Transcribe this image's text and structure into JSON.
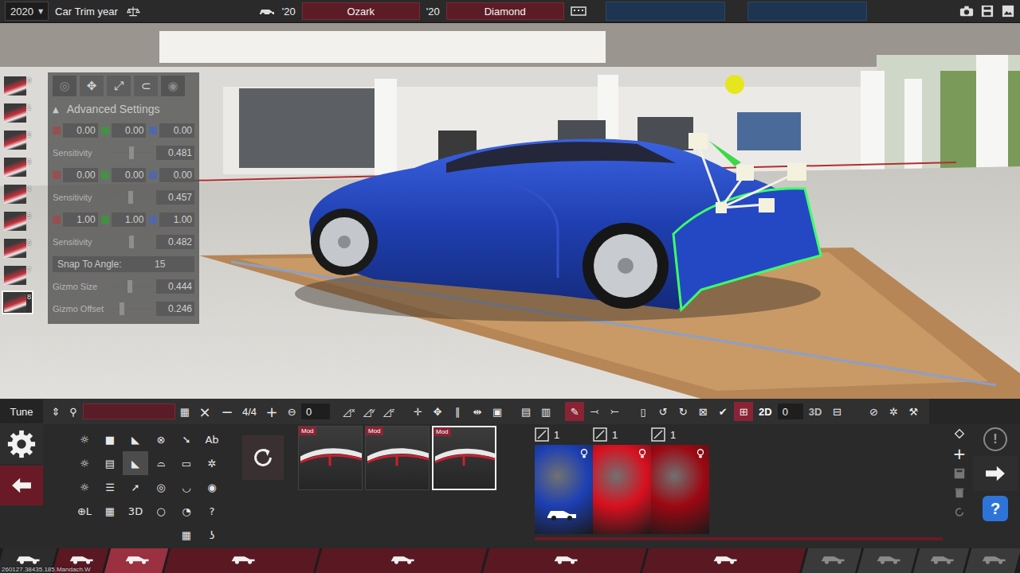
{
  "top_bar": {
    "year": {
      "value": "2020",
      "arrow": "▼"
    },
    "year_label": "Car Trim year",
    "model": {
      "year": "'20",
      "name": "Ozark"
    },
    "trim": {
      "year": "'20",
      "name": "Diamond"
    }
  },
  "fixtures": [
    {
      "index": "0",
      "selected": false
    },
    {
      "index": "1",
      "selected": false
    },
    {
      "index": "2",
      "selected": false
    },
    {
      "index": "3",
      "selected": false
    },
    {
      "index": "4",
      "selected": false
    },
    {
      "index": "5",
      "selected": false
    },
    {
      "index": "6",
      "selected": false
    },
    {
      "index": "7",
      "selected": false
    },
    {
      "index": "8",
      "selected": true
    }
  ],
  "advanced": {
    "title": "Advanced Settings",
    "arrow": "▲",
    "header_tools": [
      {
        "glyph": "◎",
        "disabled": true
      },
      {
        "glyph": "✥",
        "disabled": false
      },
      {
        "glyph": "⤢",
        "disabled": false
      },
      {
        "glyph": "⊂",
        "disabled": false
      },
      {
        "glyph": "◉",
        "disabled": true
      }
    ],
    "rows": [
      {
        "kind": "values",
        "values": [
          {
            "value": "0.00",
            "color": "#a04848"
          },
          {
            "value": "0.00",
            "color": "#3a9a3a"
          },
          {
            "value": "0.00",
            "color": "#4a66b8"
          }
        ]
      },
      {
        "kind": "slider",
        "label": "Sensitivity",
        "value": "0.481",
        "level": 0.481
      },
      {
        "kind": "values",
        "values": [
          {
            "value": "0.00",
            "color": "#a04848"
          },
          {
            "value": "0.00",
            "color": "#3a9a3a"
          },
          {
            "value": "0.00",
            "color": "#4a66b8"
          }
        ]
      },
      {
        "kind": "slider",
        "label": "Sensitivity",
        "value": "0.457",
        "level": 0.457
      },
      {
        "kind": "values",
        "values": [
          {
            "value": "1.00",
            "color": "#a04848"
          },
          {
            "value": "1.00",
            "color": "#3a9a3a"
          },
          {
            "value": "1.00",
            "color": "#4a66b8"
          }
        ]
      },
      {
        "kind": "slider",
        "label": "Sensitivity",
        "value": "0.482",
        "level": 0.482
      },
      {
        "kind": "field",
        "label": "Snap To Angle:",
        "value": "15"
      },
      {
        "kind": "slider",
        "label": "Gizmo Size",
        "value": "0.444",
        "level": 0.444
      },
      {
        "kind": "slider",
        "label": "Gizmo Offset",
        "value": "0.246",
        "level": 0.246
      }
    ]
  },
  "toolbar": {
    "tune": "Tune",
    "arrows": "⇕",
    "search": {
      "icon": "⚲",
      "value": ""
    },
    "calc": "▦",
    "clear": "×",
    "minus": "−",
    "count": "4/4",
    "plus": "+",
    "rotate": {
      "icon": "⊖",
      "value": "0"
    },
    "groups": [
      [
        {
          "glyph": "◿ˣ",
          "selected": false
        },
        {
          "glyph": "◿ʸ",
          "selected": false
        },
        {
          "glyph": "◿ᶻ",
          "selected": false
        }
      ],
      [
        {
          "glyph": "✛",
          "selected": false
        },
        {
          "glyph": "✥",
          "selected": false
        },
        {
          "glyph": "∥",
          "selected": false
        },
        {
          "glyph": "⇹",
          "selected": false
        },
        {
          "glyph": "▣",
          "selected": false
        }
      ],
      [
        {
          "glyph": "▤",
          "selected": false
        },
        {
          "glyph": "▥",
          "selected": false
        }
      ],
      [
        {
          "glyph": "✎",
          "selected": true
        },
        {
          "glyph": "⤙",
          "selected": false
        },
        {
          "glyph": "⤚",
          "selected": false
        }
      ],
      [
        {
          "glyph": "▯",
          "selected": false
        },
        {
          "glyph": "↺",
          "selected": false
        },
        {
          "glyph": "↻",
          "selected": false
        },
        {
          "glyph": "⊠",
          "selected": false
        },
        {
          "glyph": "✔",
          "selected": false
        }
      ]
    ],
    "view": {
      "icon": "⊞",
      "icon_selected": true,
      "mode_a": {
        "label": "2D",
        "selected": true
      },
      "offset": "0",
      "mode_b": {
        "label": "3D",
        "selected": false
      },
      "after": "⊟"
    },
    "end": [
      {
        "glyph": "⊘"
      },
      {
        "glyph": "✲"
      },
      {
        "glyph": "⚒"
      }
    ]
  },
  "tool_grid": [
    {
      "glyph": "☼",
      "selected": false
    },
    {
      "glyph": "■",
      "selected": false
    },
    {
      "glyph": "◣",
      "selected": false
    },
    {
      "glyph": "⊗",
      "selected": false
    },
    {
      "glyph": "➘",
      "selected": false
    },
    {
      "glyph": "Ab",
      "selected": false
    },
    {
      "glyph": "☼",
      "selected": false
    },
    {
      "glyph": "▤",
      "selected": false
    },
    {
      "glyph": "◣",
      "selected": true
    },
    {
      "glyph": "⌓",
      "selected": false
    },
    {
      "glyph": "▭",
      "selected": false
    },
    {
      "glyph": "✲",
      "selected": false
    },
    {
      "glyph": "☼",
      "selected": false
    },
    {
      "glyph": "☰",
      "selected": false
    },
    {
      "glyph": "➚",
      "selected": false
    },
    {
      "glyph": "◎",
      "selected": false
    },
    {
      "glyph": "◡",
      "selected": false
    },
    {
      "glyph": "◉",
      "selected": false
    },
    {
      "glyph": "⊕L",
      "selected": false
    },
    {
      "glyph": "▦",
      "selected": false
    },
    {
      "glyph": "3D",
      "selected": false
    },
    {
      "glyph": "○",
      "selected": false
    },
    {
      "glyph": "◔",
      "selected": false
    },
    {
      "glyph": "?",
      "selected": false
    },
    {
      "glyph": "▦",
      "selected": false
    },
    {
      "glyph": "ʖ",
      "selected": false
    }
  ],
  "variants": [
    {
      "badge": "Mod",
      "selected": false
    },
    {
      "badge": "Mod",
      "selected": false
    },
    {
      "badge": "Mod",
      "selected": true
    }
  ],
  "materials": [
    {
      "count": "1",
      "color": "#1c3fb4",
      "selected": true
    },
    {
      "count": "1",
      "color": "#d8101e",
      "selected": false
    },
    {
      "count": "1",
      "color": "#9c0812",
      "selected": false
    }
  ],
  "side_buttons": {
    "warning": "!",
    "add": "+",
    "help": "?"
  },
  "nav": [
    {
      "selected": false,
      "disabled": false
    },
    {
      "selected": false,
      "disabled": false
    },
    {
      "selected": true,
      "disabled": false
    },
    {
      "selected": false,
      "disabled": false
    },
    {
      "selected": false,
      "disabled": false
    },
    {
      "selected": false,
      "disabled": false
    },
    {
      "selected": false,
      "disabled": false
    },
    {
      "selected": false,
      "disabled": true
    },
    {
      "selected": false,
      "disabled": true
    },
    {
      "selected": false,
      "disabled": true
    },
    {
      "selected": false,
      "disabled": true
    }
  ],
  "watermark": "260127.38435.185.Mandach.W"
}
